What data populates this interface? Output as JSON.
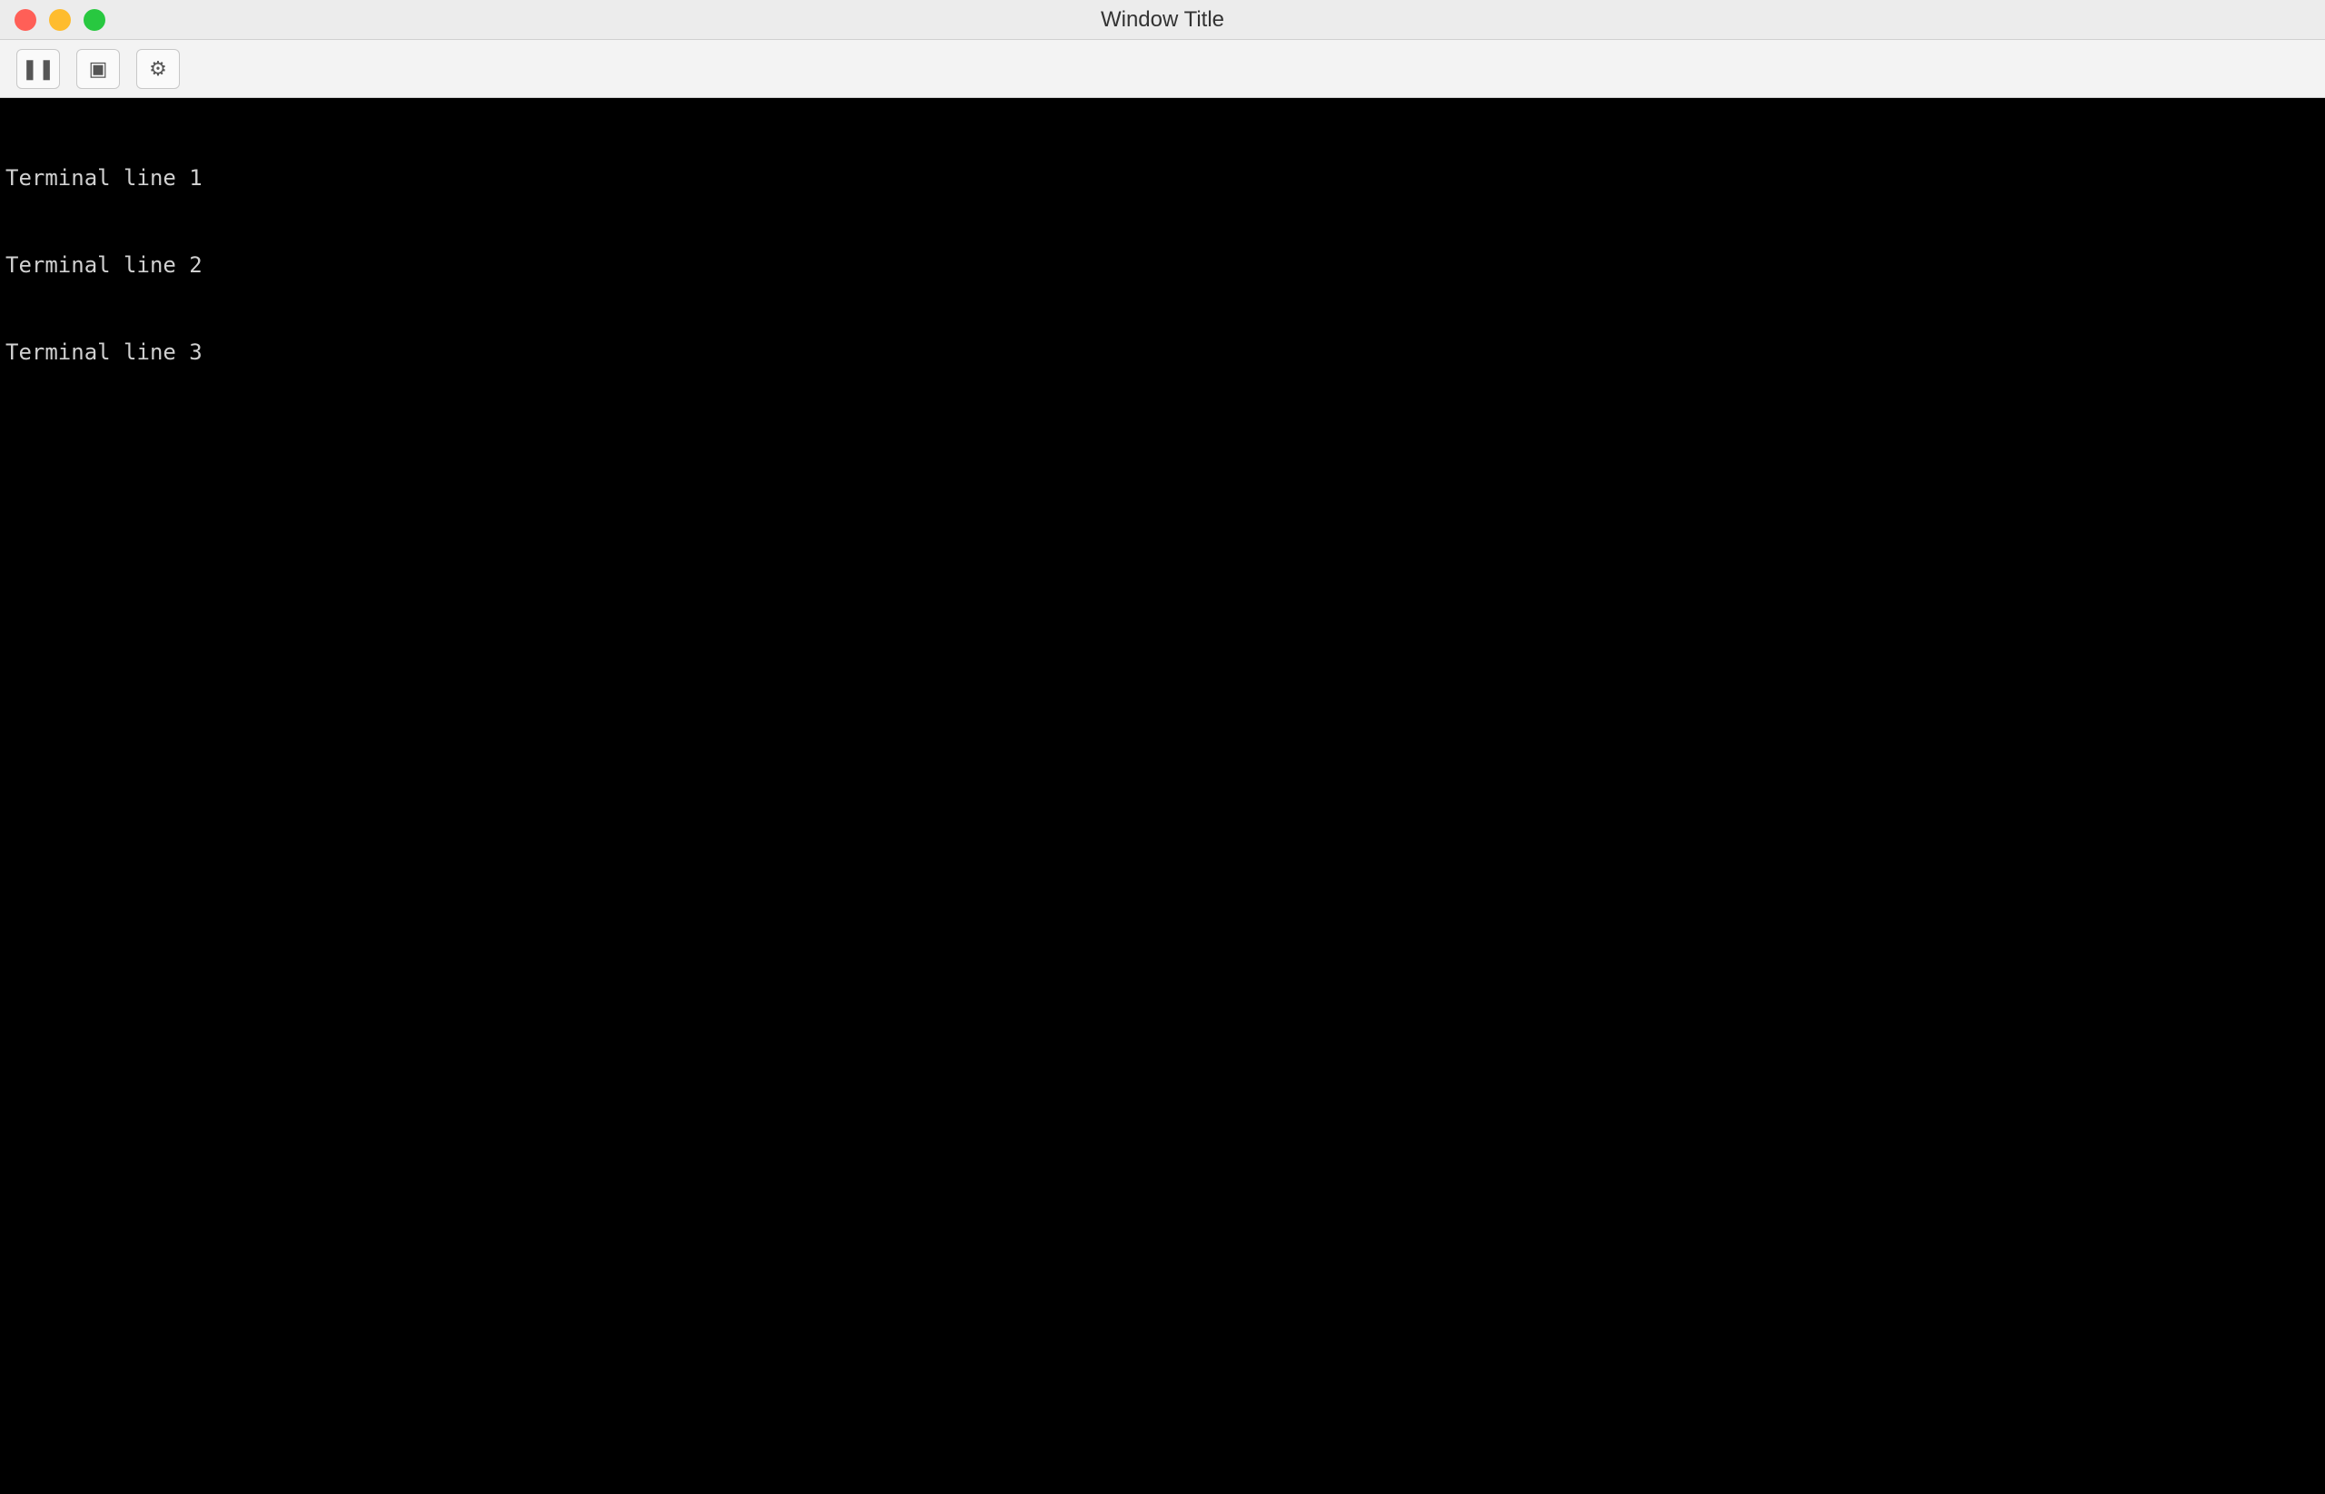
{
  "window": {
    "title": "Window Title"
  },
  "toolbar": {
    "buttons": [
      {
        "icon": "pause-icon"
      },
      {
        "icon": "snapshot-icon"
      },
      {
        "icon": "settings-icon"
      }
    ]
  },
  "terminal": {
    "lines": [
      "Terminal line 1",
      "Terminal line 2",
      "Terminal line 3"
    ]
  }
}
